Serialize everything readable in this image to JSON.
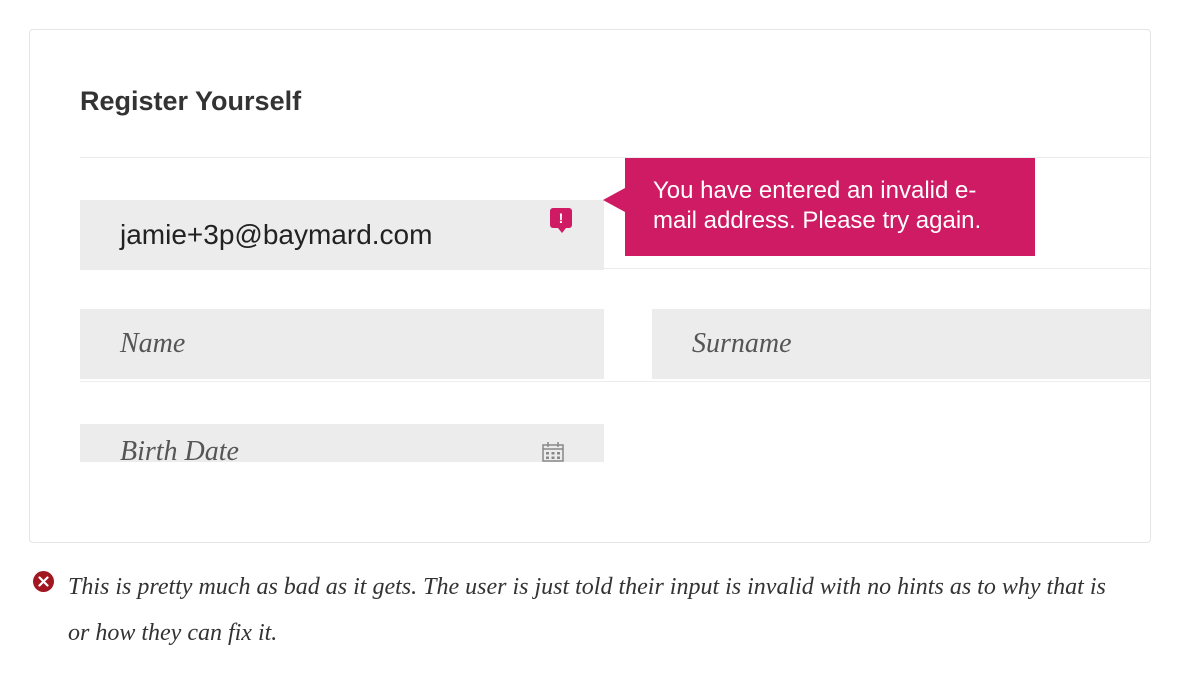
{
  "colors": {
    "error_accent": "#cf1a64",
    "caption_icon": "#a21621",
    "field_bg": "#ececec"
  },
  "form": {
    "title": "Register Yourself",
    "email": {
      "value": "jamie+3p@baymard.com",
      "error_message": "You have entered an invalid e-mail address. Please try again."
    },
    "name_placeholder": "Name",
    "surname_placeholder": "Surname",
    "birth_placeholder": "Birth Date"
  },
  "caption": {
    "text": "This is pretty much as bad as it gets. The user is just told their input is invalid with no hints as to why that is or how they can fix it."
  }
}
